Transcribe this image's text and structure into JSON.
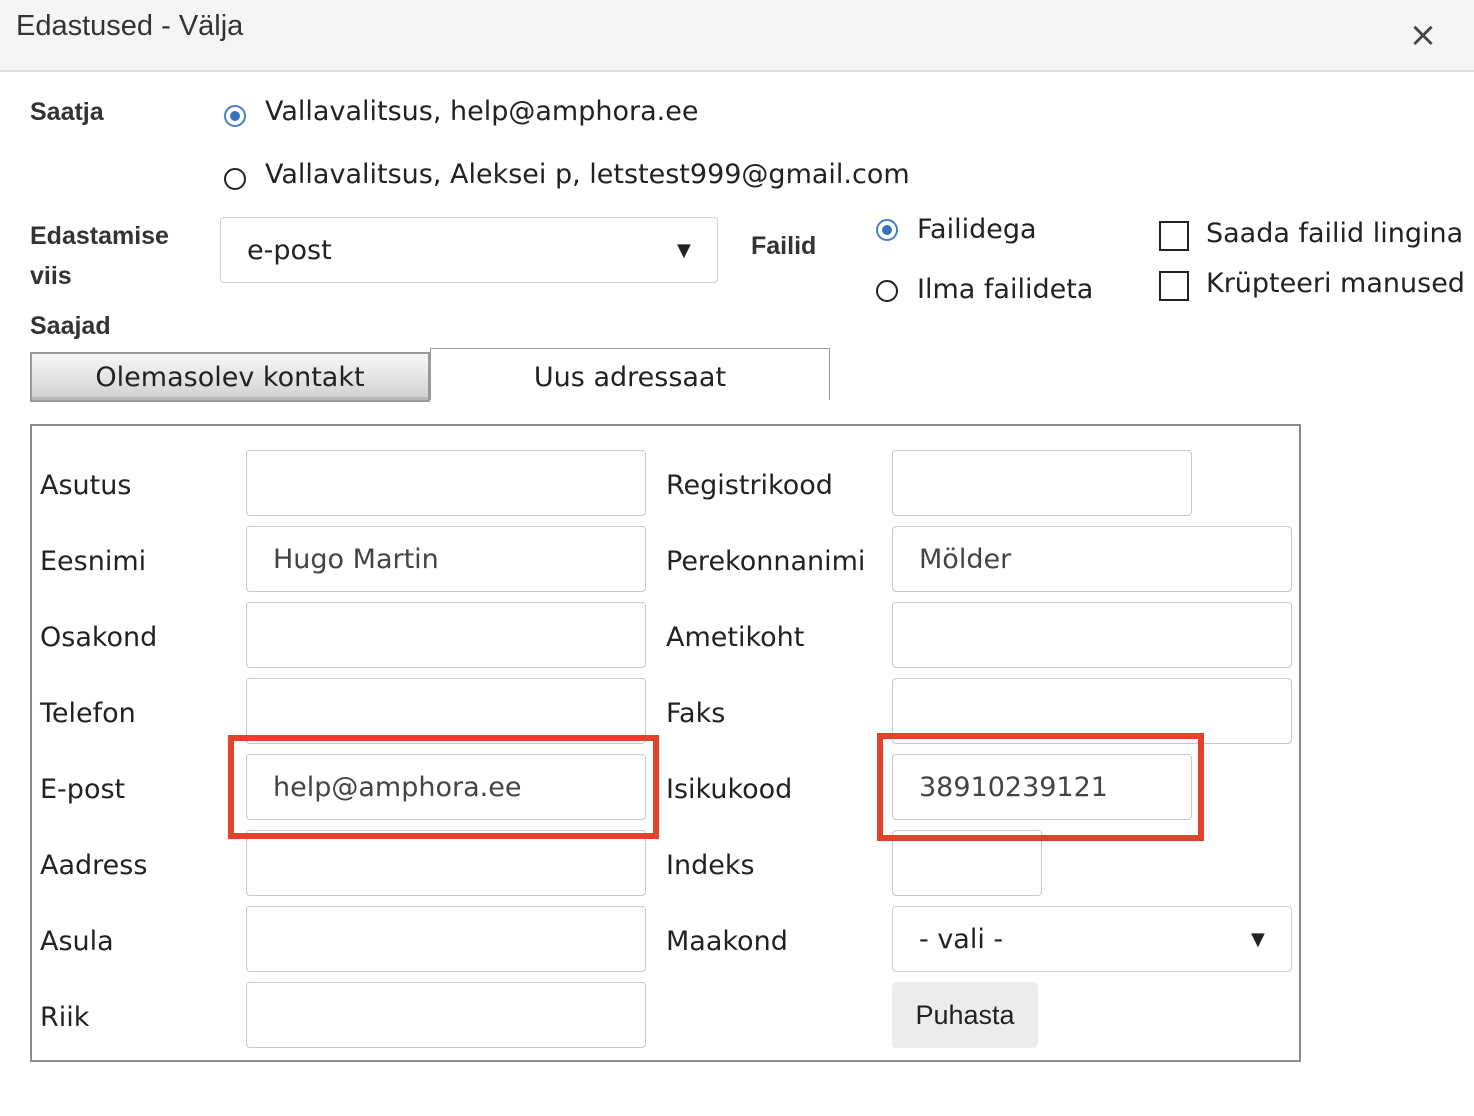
{
  "dialog": {
    "title": "Edastused - Välja",
    "close_symbol": "×"
  },
  "sender": {
    "label": "Saatja",
    "options": [
      {
        "text": "Vallavalitsus, help@amphora.ee",
        "selected": true
      },
      {
        "text": "Vallavalitsus, Aleksei p, letstest999@gmail.com",
        "selected": false
      }
    ]
  },
  "method": {
    "label_line1": "Edastamise",
    "label_line2": "viis",
    "value": "e-post",
    "arrow": "▼"
  },
  "files": {
    "label": "Failid",
    "options": [
      {
        "text": "Failidega",
        "selected": true
      },
      {
        "text": "Ilma failideta",
        "selected": false
      }
    ],
    "checkboxes": [
      {
        "text": "Saada failid lingina",
        "checked": false
      },
      {
        "text": "Krüpteeri manused",
        "checked": false
      }
    ]
  },
  "recipients": {
    "label": "Saajad",
    "tabs": [
      {
        "label": "Olemasolev kontakt"
      },
      {
        "label": "Uus adressaat",
        "active": true
      }
    ]
  },
  "form": {
    "asutus": {
      "label": "Asutus",
      "value": ""
    },
    "registrikood": {
      "label": "Registrikood",
      "value": ""
    },
    "eesnimi": {
      "label": "Eesnimi",
      "value": "Hugo Martin"
    },
    "perekonnanimi": {
      "label": "Perekonnanimi",
      "value": "Mölder"
    },
    "osakond": {
      "label": "Osakond",
      "value": ""
    },
    "ametikoht": {
      "label": "Ametikoht",
      "value": ""
    },
    "telefon": {
      "label": "Telefon",
      "value": ""
    },
    "faks": {
      "label": "Faks",
      "value": ""
    },
    "epost": {
      "label": "E-post",
      "value": "help@amphora.ee"
    },
    "isikukood": {
      "label": "Isikukood",
      "value": "38910239121"
    },
    "aadress": {
      "label": "Aadress",
      "value": ""
    },
    "indeks": {
      "label": "Indeks",
      "value": ""
    },
    "asula": {
      "label": "Asula",
      "value": ""
    },
    "maakond": {
      "label": "Maakond",
      "value": "- vali -",
      "arrow": "▼"
    },
    "riik": {
      "label": "Riik",
      "value": ""
    },
    "clear_button": "Puhasta"
  },
  "colors": {
    "highlight": "#e4402a",
    "radio_selected": "#3b73b9"
  }
}
